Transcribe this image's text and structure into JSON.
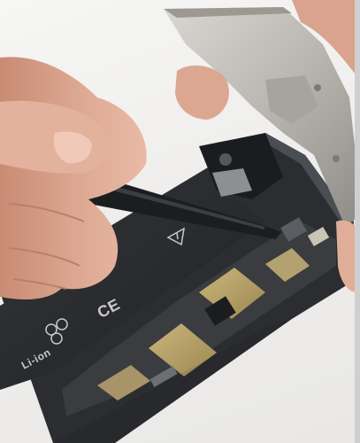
{
  "scene": {
    "subject": "smartphone-repair",
    "battery_label": {
      "ce_mark": "CE",
      "chemistry": "Li-ion"
    }
  },
  "colors": {
    "background": "#efeeec",
    "phone_body": "#2b2d31",
    "battery": "#26282b",
    "skin": "#d9a38d",
    "skin_shadow": "#b9806b",
    "spudger": "#1c1d1f",
    "metal_shield": "#c6c3bd",
    "gold_contacts": "#b9a36a"
  }
}
